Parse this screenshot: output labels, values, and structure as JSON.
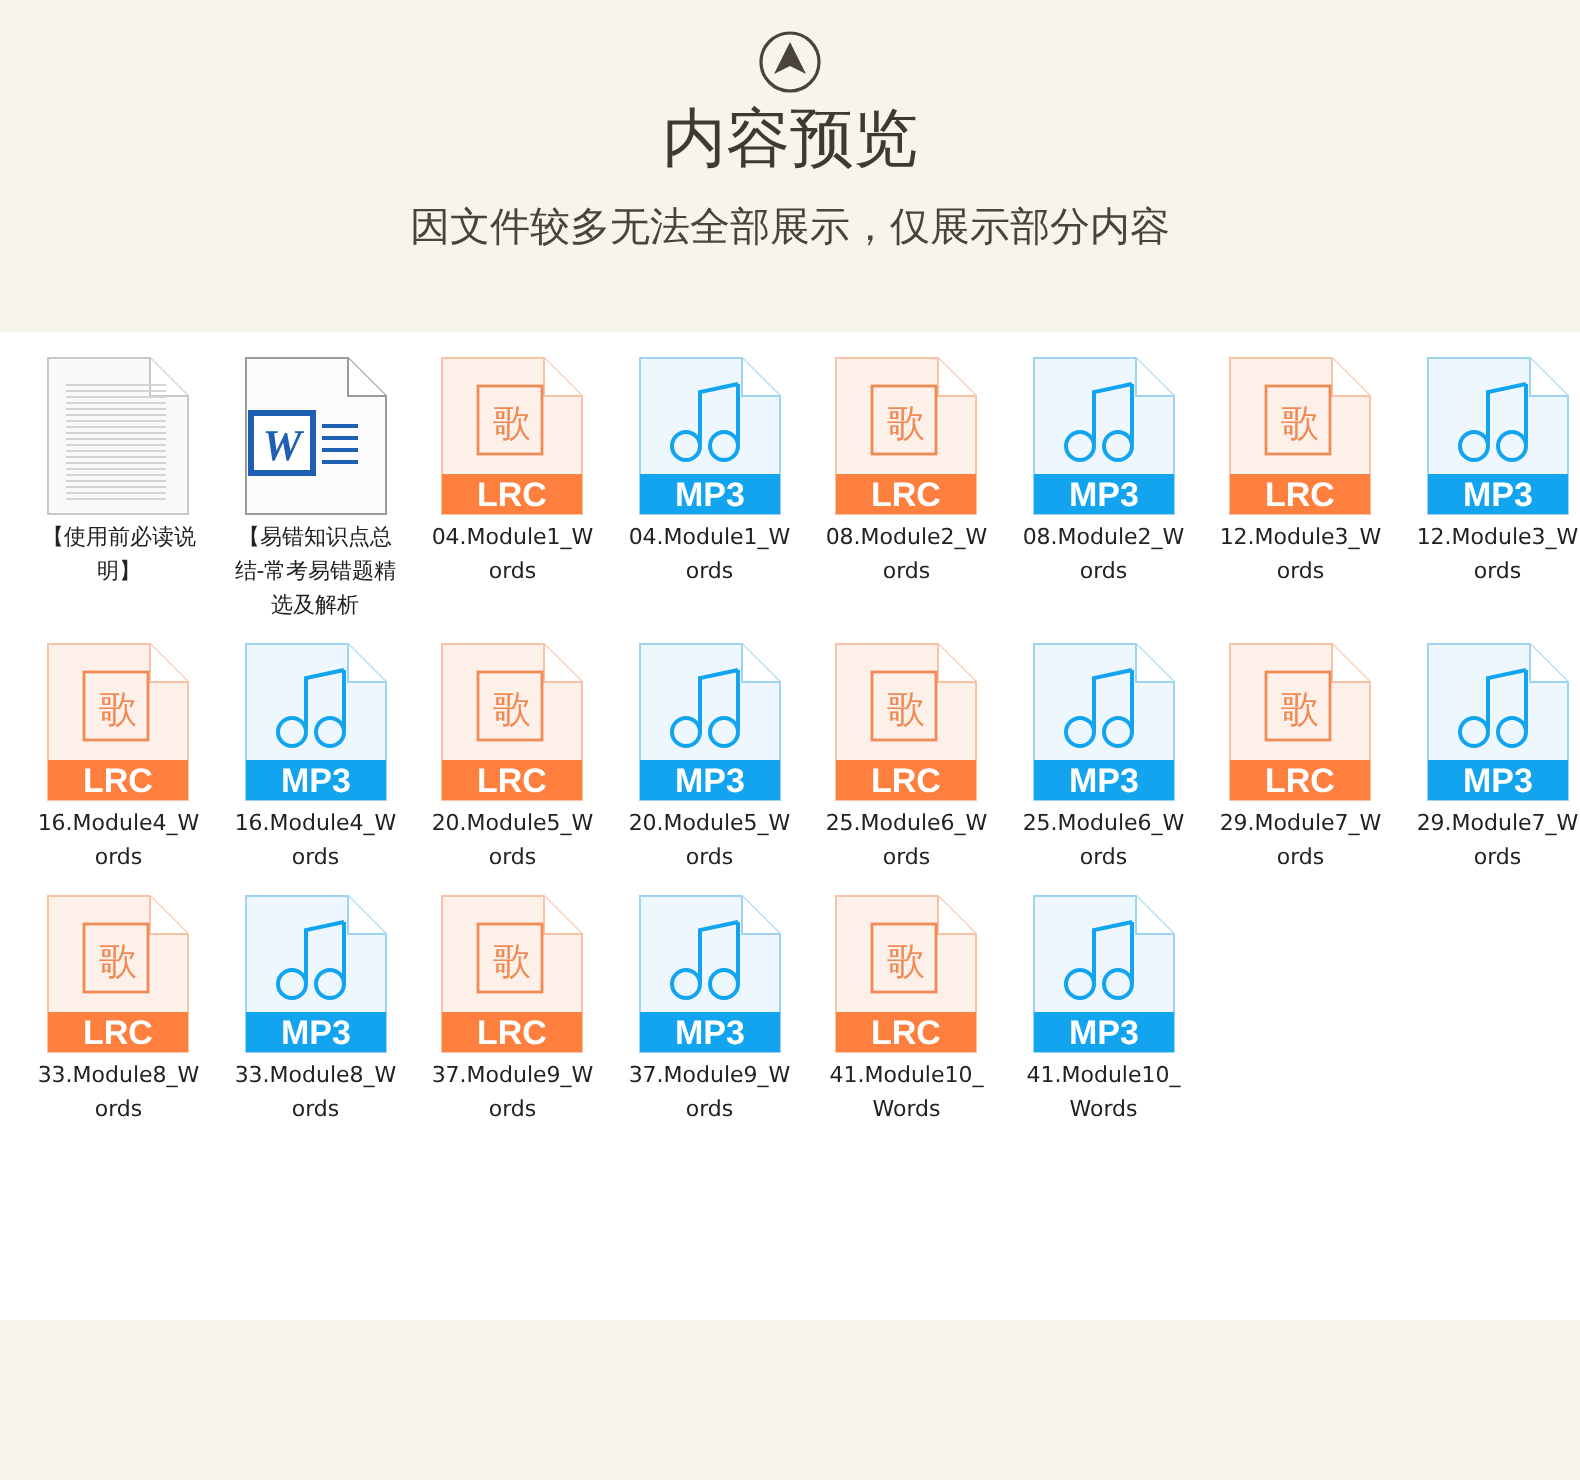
{
  "header": {
    "title": "内容预览",
    "subtitle": "因文件较多无法全部展示，仅展示部分内容"
  },
  "files": [
    {
      "kind": "text",
      "label": [
        "【使用前必读说",
        "明】"
      ]
    },
    {
      "kind": "word",
      "glyph": "W",
      "label": [
        "【易错知识点总",
        "结-常考易错题精",
        "选及解析"
      ]
    },
    {
      "kind": "lrc",
      "glyph": "歌",
      "badge": "LRC",
      "label": [
        "04.Module1_W",
        "ords"
      ]
    },
    {
      "kind": "mp3",
      "badge": "MP3",
      "label": [
        "04.Module1_W",
        "ords"
      ]
    },
    {
      "kind": "lrc",
      "glyph": "歌",
      "badge": "LRC",
      "label": [
        "08.Module2_W",
        "ords"
      ]
    },
    {
      "kind": "mp3",
      "badge": "MP3",
      "label": [
        "08.Module2_W",
        "ords"
      ]
    },
    {
      "kind": "lrc",
      "glyph": "歌",
      "badge": "LRC",
      "label": [
        "12.Module3_W",
        "ords"
      ]
    },
    {
      "kind": "mp3",
      "badge": "MP3",
      "label": [
        "12.Module3_W",
        "ords"
      ]
    },
    {
      "kind": "lrc",
      "glyph": "歌",
      "badge": "LRC",
      "label": [
        "16.Module4_W",
        "ords"
      ]
    },
    {
      "kind": "mp3",
      "badge": "MP3",
      "label": [
        "16.Module4_W",
        "ords"
      ]
    },
    {
      "kind": "lrc",
      "glyph": "歌",
      "badge": "LRC",
      "label": [
        "20.Module5_W",
        "ords"
      ]
    },
    {
      "kind": "mp3",
      "badge": "MP3",
      "label": [
        "20.Module5_W",
        "ords"
      ]
    },
    {
      "kind": "lrc",
      "glyph": "歌",
      "badge": "LRC",
      "label": [
        "25.Module6_W",
        "ords"
      ]
    },
    {
      "kind": "mp3",
      "badge": "MP3",
      "label": [
        "25.Module6_W",
        "ords"
      ]
    },
    {
      "kind": "lrc",
      "glyph": "歌",
      "badge": "LRC",
      "label": [
        "29.Module7_W",
        "ords"
      ]
    },
    {
      "kind": "mp3",
      "badge": "MP3",
      "label": [
        "29.Module7_W",
        "ords"
      ]
    },
    {
      "kind": "lrc",
      "glyph": "歌",
      "badge": "LRC",
      "label": [
        "33.Module8_W",
        "ords"
      ]
    },
    {
      "kind": "mp3",
      "badge": "MP3",
      "label": [
        "33.Module8_W",
        "ords"
      ]
    },
    {
      "kind": "lrc",
      "glyph": "歌",
      "badge": "LRC",
      "label": [
        "37.Module9_W",
        "ords"
      ]
    },
    {
      "kind": "mp3",
      "badge": "MP3",
      "label": [
        "37.Module9_W",
        "ords"
      ]
    },
    {
      "kind": "lrc",
      "glyph": "歌",
      "badge": "LRC",
      "label": [
        "41.Module10_",
        "Words"
      ]
    },
    {
      "kind": "mp3",
      "badge": "MP3",
      "label": [
        "41.Module10_",
        "Words"
      ]
    }
  ]
}
